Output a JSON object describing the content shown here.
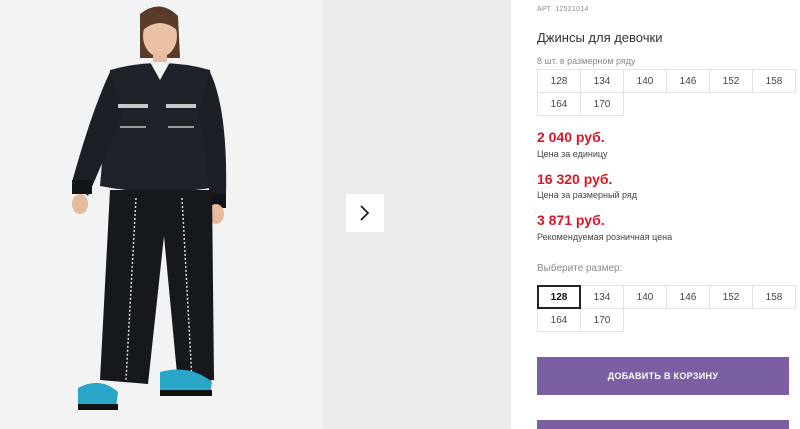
{
  "product": {
    "article_label": "АРТ",
    "article_number": "12521014",
    "title": "Джинсы для девочки",
    "row_note": "8 шт. в размерном ряду"
  },
  "size_row": [
    "128",
    "134",
    "140",
    "146",
    "152",
    "158",
    "164",
    "170"
  ],
  "prices": [
    {
      "value": "2 040 руб.",
      "label": "Цена за единицу"
    },
    {
      "value": "16 320 руб.",
      "label": "Цена за размерный ряд"
    },
    {
      "value": "3 871 руб.",
      "label": "Рекомендуемая розничная цена"
    }
  ],
  "choose_size": {
    "label": "Выберите размер:",
    "options": [
      "128",
      "134",
      "140",
      "146",
      "152",
      "158",
      "164",
      "170"
    ],
    "selected": "128"
  },
  "cart_button": "ДОБАВИТЬ В КОРЗИНУ",
  "colors": {
    "accent": "#7b5fa3",
    "price": "#d6182a"
  },
  "icons": {
    "next": "chevron-right-icon"
  }
}
